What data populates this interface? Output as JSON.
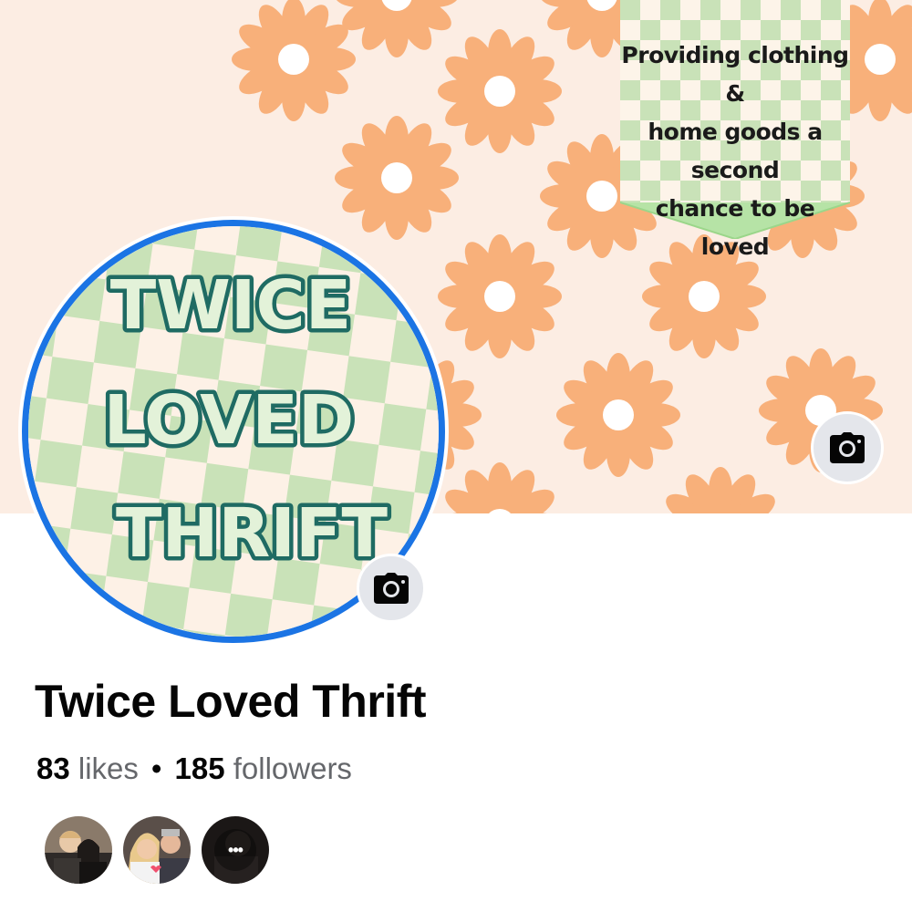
{
  "cover": {
    "tagline_lines": [
      "Providing clothing &",
      "home goods a second",
      "chance to be loved"
    ],
    "camera_icon": "camera-icon"
  },
  "profile": {
    "logo_words": [
      "TWICE",
      "LOVED",
      "THRIFT"
    ],
    "camera_icon": "camera-icon",
    "ring_color": "#1b74e4"
  },
  "page": {
    "name": "Twice Loved Thrift",
    "likes_count": "83",
    "likes_label": "likes",
    "separator": "•",
    "followers_count": "185",
    "followers_label": "followers"
  },
  "friends": {
    "more_label": "•••"
  },
  "colors": {
    "cover_bg": "#fcede3",
    "flower": "#f8b07a",
    "checker_green": "#c9e2b8",
    "logo_text": "#e3f2d9",
    "logo_outline": "#1f6b63"
  }
}
